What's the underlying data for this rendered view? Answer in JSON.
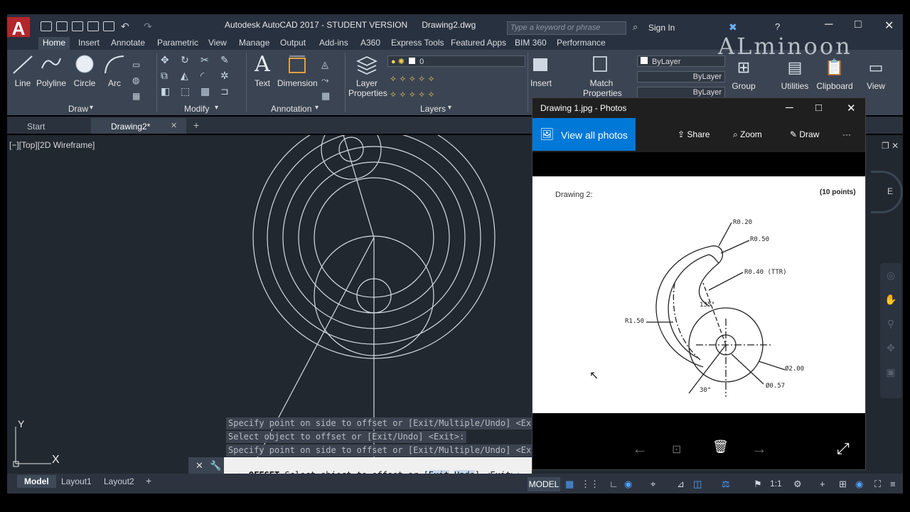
{
  "app": {
    "title": "Autodesk AutoCAD 2017 - STUDENT VERSION      Drawing2.dwg",
    "logo": "A",
    "search_placeholder": "Type a keyword or phrase",
    "signin": "Sign In",
    "watermark": "ALminoon"
  },
  "ribbon_tabs": [
    "Home",
    "Insert",
    "Annotate",
    "Parametric",
    "View",
    "Manage",
    "Output",
    "Add-ins",
    "A360",
    "Express Tools",
    "Featured Apps",
    "BIM 360",
    "Performance"
  ],
  "ribbon": {
    "draw_tools": [
      "Line",
      "Polyline",
      "Circle",
      "Arc"
    ],
    "draw_panel": "Draw",
    "modify_panel": "Modify",
    "annotation_tools": [
      "Text",
      "Dimension"
    ],
    "annotation_panel": "Annotation",
    "layer_props": "Layer Properties",
    "layer_current": "0",
    "layers_panel": "Layers",
    "insert": "Insert",
    "match_props": "Match Properties",
    "bylayer": [
      "ByLayer",
      "ByLayer",
      "ByLayer"
    ],
    "group": "Group",
    "utilities": "Utilities",
    "clipboard": "Clipboard",
    "view": "View"
  },
  "file_tabs": [
    "Start",
    "Drawing2*"
  ],
  "viewport_label": "[−][Top][2D Wireframe]",
  "command_history": [
    "Specify point on side to offset or [Exit/Multiple/Undo] <Exit>:",
    "Select object to offset or [Exit/Undo] <Exit>:",
    "Specify point on side to offset or [Exit/Multiple/Undo] <Exit>:"
  ],
  "command_line": {
    "cmd": "OFFSET",
    "prompt": "Select object to offset or [",
    "opt1": "Exit",
    "opt2": "Undo",
    "suffix": "] <Exit>:"
  },
  "layout_tabs": [
    "Model",
    "Layout1",
    "Layout2"
  ],
  "status": {
    "model": "MODEL",
    "scale": "1:1"
  },
  "ucs": {
    "x": "X",
    "y": "Y"
  },
  "photos": {
    "title": "Drawing 1.jpg - Photos",
    "view_all": "View all photos",
    "share": "Share",
    "zoom": "Zoom",
    "draw": "Draw",
    "more": "···",
    "drawing": {
      "header": "Drawing 2:",
      "points": "(10 points)",
      "r020": "R0.20",
      "r050": "R0.50",
      "r040": "R0.40 (TTR)",
      "angle135": "135°",
      "r150": "R1.50",
      "d200": "Ø2.00",
      "d057": "Ø0.57",
      "angle30": "30°"
    }
  },
  "viewcube_label": "E"
}
